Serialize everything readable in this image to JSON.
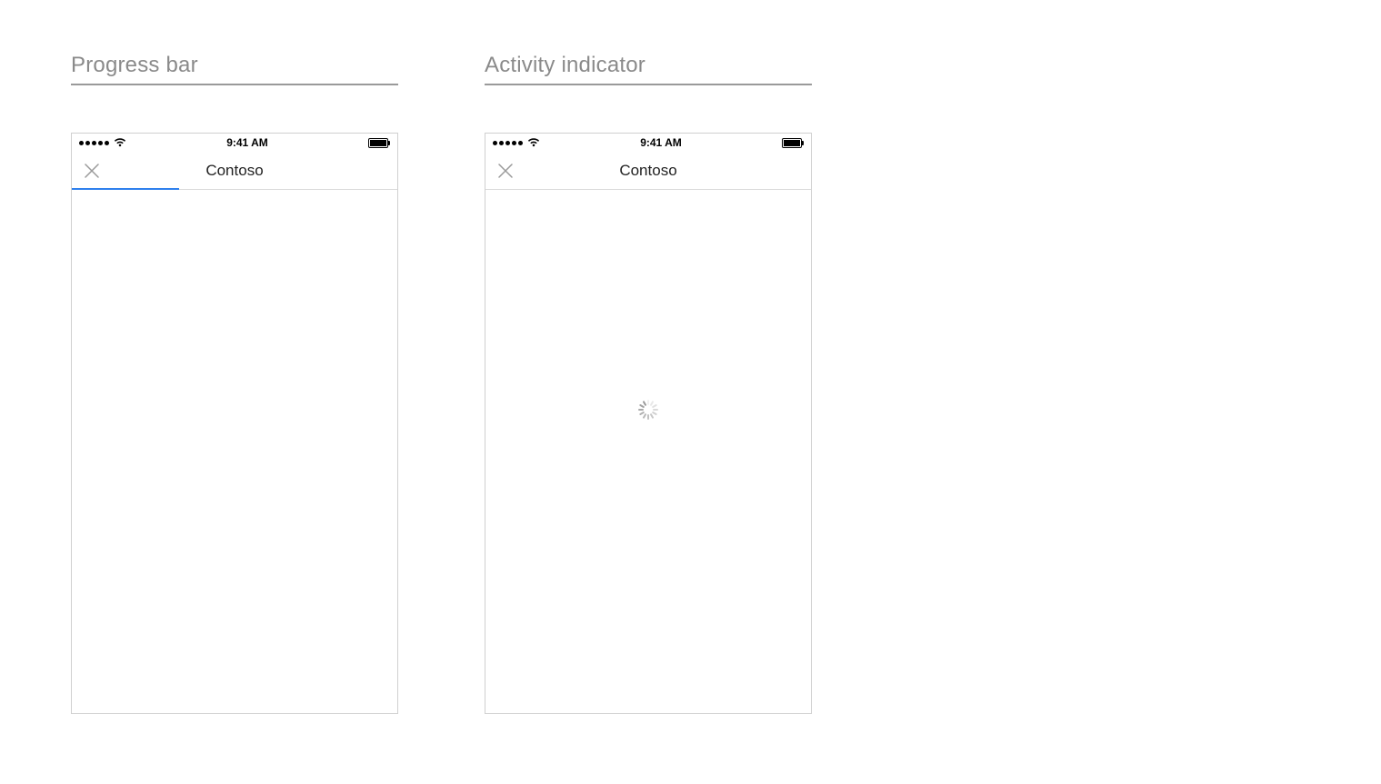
{
  "sections": {
    "progress": {
      "heading": "Progress bar",
      "status_time": "9:41 AM",
      "nav_title": "Contoso",
      "progress_percent": 33
    },
    "activity": {
      "heading": "Activity indicator",
      "status_time": "9:41 AM",
      "nav_title": "Contoso"
    }
  },
  "colors": {
    "heading_text": "#8a8a8a",
    "heading_rule": "#9a9a9a",
    "progress_fill": "#2f80ed",
    "nav_border": "#d9d9d9",
    "spinner_spoke": "#9a9a9a"
  }
}
